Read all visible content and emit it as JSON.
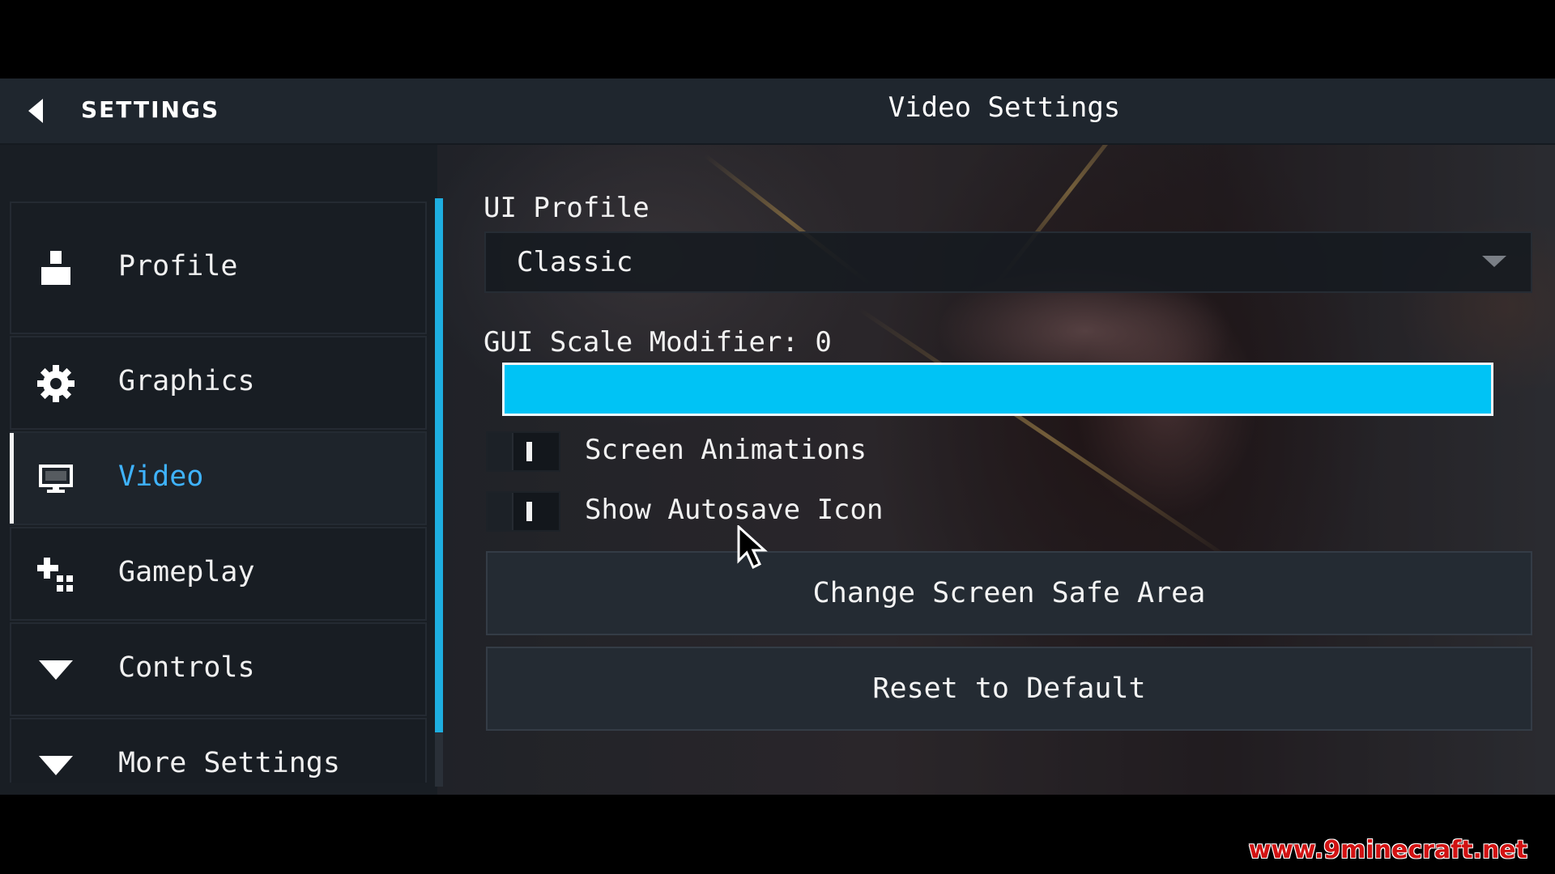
{
  "header": {
    "back_icon": "back-arrow-icon",
    "title": "SETTINGS",
    "page_title": "Video Settings"
  },
  "sidebar": {
    "items": [
      {
        "label": "Profile",
        "icon": "profile-icon",
        "active": false
      },
      {
        "label": "Graphics",
        "icon": "gear-icon",
        "active": false
      },
      {
        "label": "Video",
        "icon": "monitor-icon",
        "active": true
      },
      {
        "label": "Gameplay",
        "icon": "gameplay-icon",
        "active": false
      },
      {
        "label": "Controls",
        "icon": "chevron-down-icon",
        "active": false
      },
      {
        "label": "More Settings",
        "icon": "chevron-down-icon",
        "active": false
      }
    ],
    "accent_color": "#1eaee0"
  },
  "video": {
    "ui_profile": {
      "label": "UI Profile",
      "value": "Classic"
    },
    "gui_scale": {
      "label": "GUI Scale Modifier: 0",
      "slider_color": "#00c3f5"
    },
    "toggles": [
      {
        "label": "Screen Animations",
        "state": "on"
      },
      {
        "label": "Show Autosave Icon",
        "state": "on"
      }
    ],
    "buttons": {
      "safe_area": "Change Screen Safe Area",
      "reset": "Reset to Default"
    }
  },
  "watermark": "www.9minecraft.net"
}
